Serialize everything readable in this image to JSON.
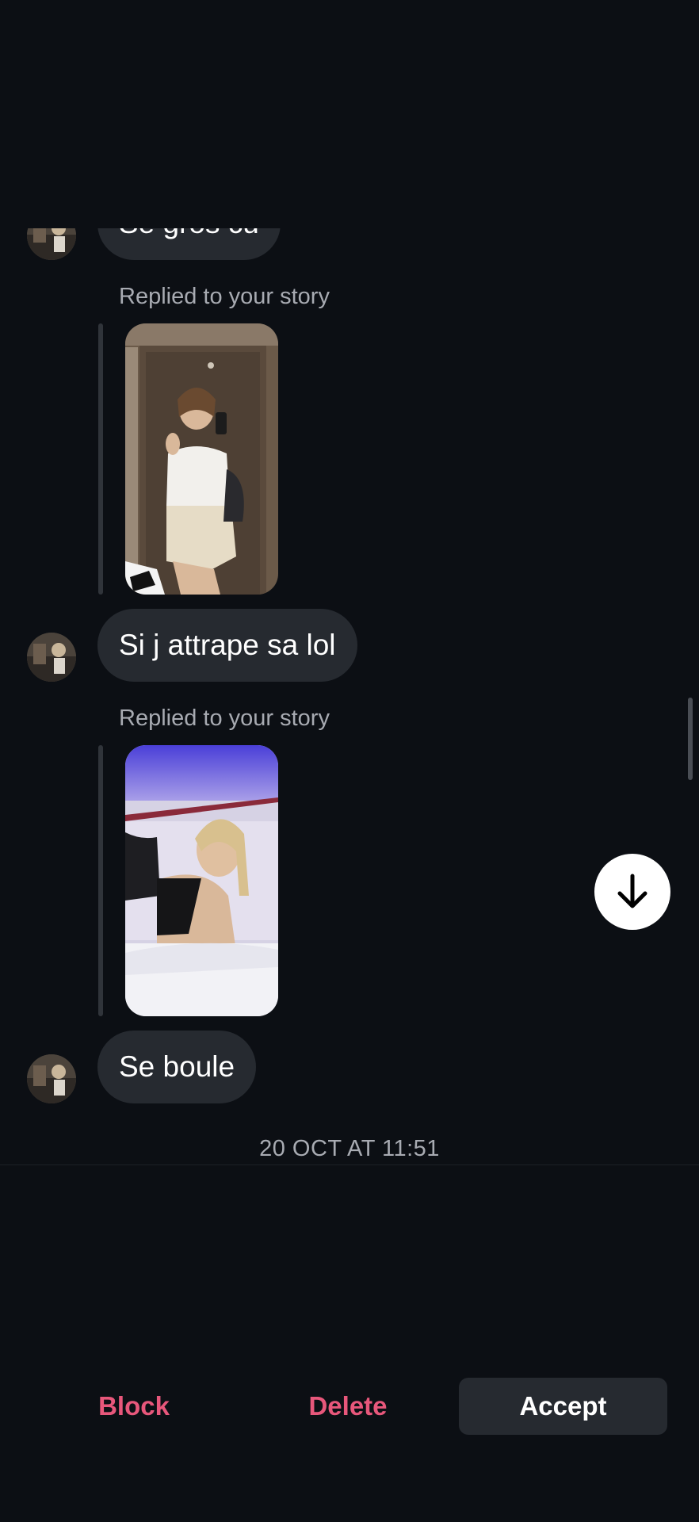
{
  "thread": {
    "messages": [
      {
        "type": "text",
        "text": "Se gros cu"
      },
      {
        "type": "story_reply",
        "label": "Replied to your story"
      },
      {
        "type": "text",
        "text": "Si j attrape sa lol"
      },
      {
        "type": "story_reply",
        "label": "Replied to your story"
      },
      {
        "type": "text",
        "text": "Se boule"
      }
    ],
    "timestamp": "20 OCT AT 11:51"
  },
  "icons": {
    "jump_to_latest": "arrow-down-icon"
  },
  "actions": {
    "block_label": "Block",
    "delete_label": "Delete",
    "accept_label": "Accept"
  },
  "colors": {
    "background": "#0c0f14",
    "bubble": "#262a30",
    "destructive": "#e8577b",
    "muted_text": "#a8abb2"
  }
}
